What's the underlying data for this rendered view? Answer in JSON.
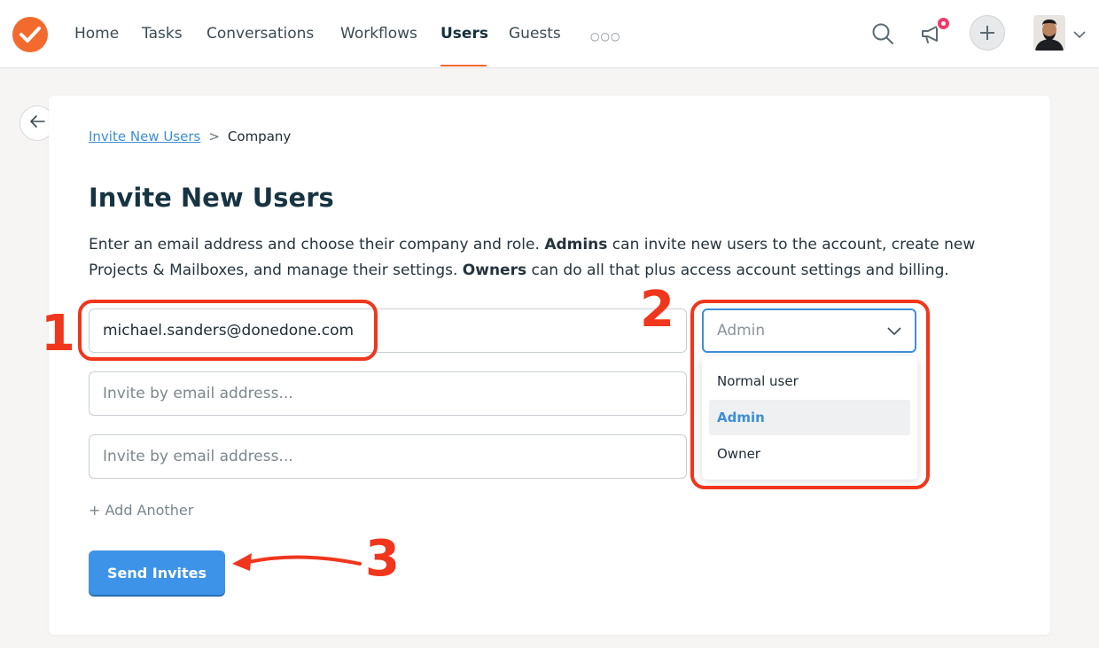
{
  "nav": {
    "items": [
      "Home",
      "Tasks",
      "Conversations",
      "Workflows",
      "Users",
      "Guests"
    ],
    "active": "Users",
    "more_icon": "more-dots-icon"
  },
  "page": {
    "back_icon": "arrow-left-icon",
    "breadcrumb": {
      "link": "Invite New Users",
      "separator": ">",
      "current": "Company"
    },
    "title": "Invite New Users",
    "description": {
      "part1": "Enter an email address and choose their company and role. ",
      "bold1": "Admins",
      "part2": " can invite new users to the account, create new Projects & Mailboxes, and manage their settings. ",
      "bold2": "Owners",
      "part3": " can do all that plus access account settings and billing."
    }
  },
  "form": {
    "emails": [
      {
        "value": "michael.sanders@donedone.com",
        "placeholder": "Invite by email address..."
      },
      {
        "value": "",
        "placeholder": "Invite by email address..."
      },
      {
        "value": "",
        "placeholder": "Invite by email address..."
      }
    ],
    "role": {
      "selected": "Admin",
      "options": [
        "Normal user",
        "Admin",
        "Owner"
      ]
    },
    "add_another": "+ Add Another",
    "send": "Send Invites"
  },
  "annotations": {
    "one": "1",
    "two": "2",
    "three": "3"
  },
  "colors": {
    "accent": "#f26a2e",
    "link": "#3d8fd6",
    "annotation": "#f0361c"
  }
}
